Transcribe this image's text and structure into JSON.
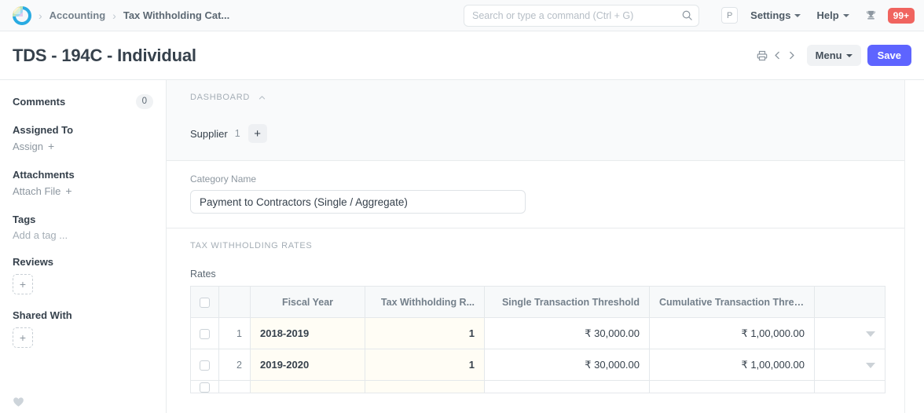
{
  "navbar": {
    "logo_name": "frappe-logo",
    "breadcrumbs": [
      {
        "label": "Accounting"
      },
      {
        "label": "Tax Withholding Cat..."
      }
    ],
    "search": {
      "placeholder": "Search or type a command (Ctrl + G)",
      "value": ""
    },
    "avatar_initial": "P",
    "settings_label": "Settings",
    "help_label": "Help",
    "notification_badge": "99+",
    "badge_color": "#f0645f"
  },
  "page": {
    "title": "TDS - 194C - Individual",
    "menu_label": "Menu",
    "save_label": "Save",
    "primary_color": "#5e64ff"
  },
  "sidebar": {
    "comments_label": "Comments",
    "comments_count": "0",
    "assigned_to_label": "Assigned To",
    "assign_label": "Assign",
    "attachments_label": "Attachments",
    "attach_file_label": "Attach File",
    "tags_label": "Tags",
    "add_tag_label": "Add a tag ...",
    "reviews_label": "Reviews",
    "shared_with_label": "Shared With"
  },
  "main": {
    "dashboard_section_label": "DASHBOARD",
    "dashboard_items": [
      {
        "label": "Supplier",
        "count": "1"
      }
    ],
    "category_name_label": "Category Name",
    "category_name_value": "Payment to Contractors (Single / Aggregate)",
    "rates_section_label": "TAX WITHHOLDING RATES",
    "rates_grid_label": "Rates",
    "grid": {
      "columns": [
        "Fiscal Year",
        "Tax Withholding R...",
        "Single Transaction Threshold",
        "Cumulative Transaction Thres..."
      ],
      "rows": [
        {
          "index": "1",
          "fiscal_year": "2018-2019",
          "rate": "1",
          "single_threshold": "₹ 30,000.00",
          "cumulative_threshold": "₹ 1,00,000.00"
        },
        {
          "index": "2",
          "fiscal_year": "2019-2020",
          "rate": "1",
          "single_threshold": "₹ 30,000.00",
          "cumulative_threshold": "₹ 1,00,000.00"
        }
      ]
    }
  }
}
